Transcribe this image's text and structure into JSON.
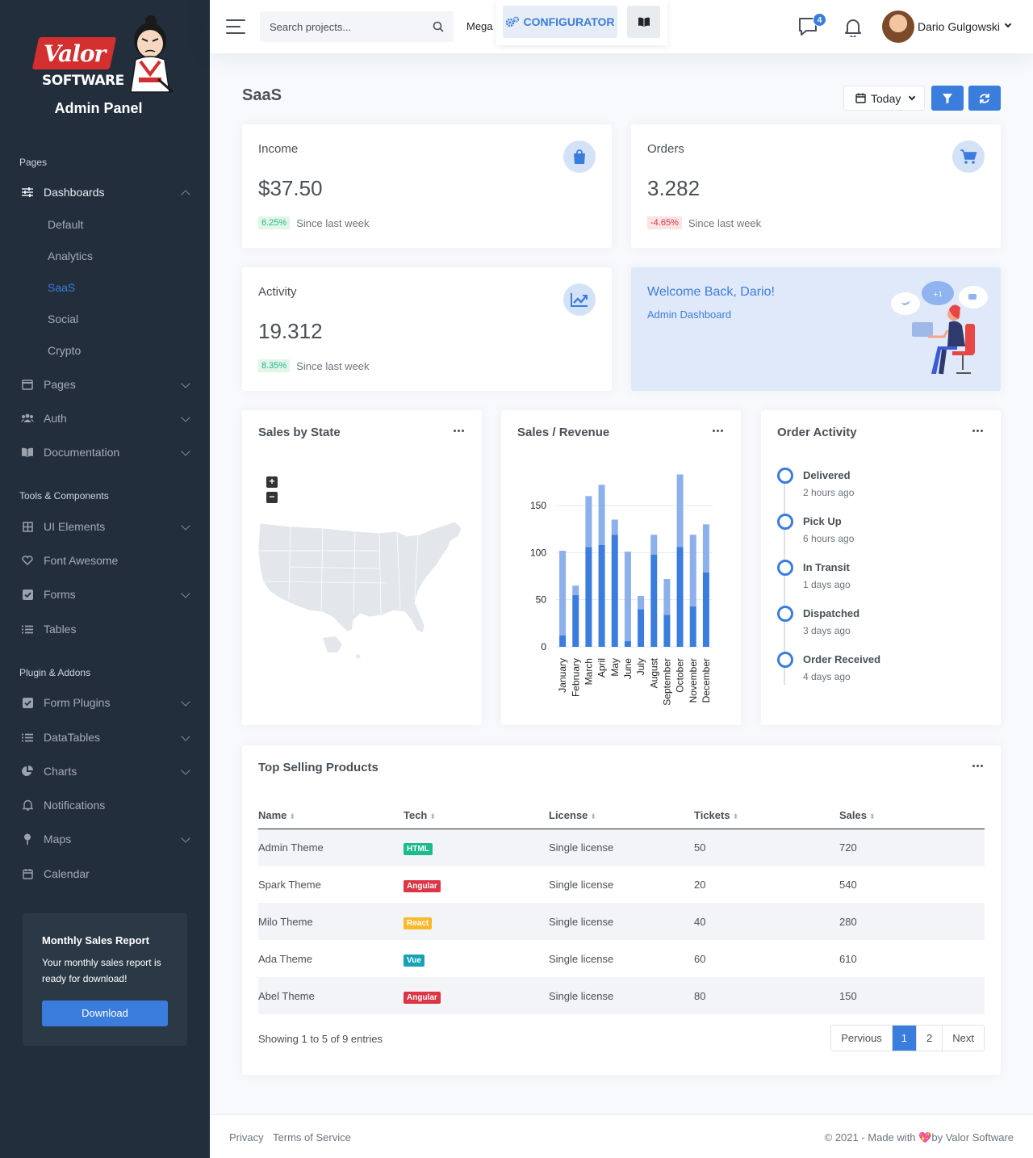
{
  "brand": {
    "logo_word": "Valor",
    "logo_sub": "SOFTWARE",
    "subtitle": "Admin Panel"
  },
  "sidebar": {
    "sections": {
      "pages": "Pages",
      "tools": "Tools & Components",
      "plugins": "Plugin & Addons"
    },
    "dashboards": {
      "label": "Dashboards",
      "children": [
        "Default",
        "Analytics",
        "SaaS",
        "Social",
        "Crypto"
      ],
      "active": "SaaS"
    },
    "items": [
      {
        "label": "Pages",
        "icon": "layout-icon"
      },
      {
        "label": "Auth",
        "icon": "users-icon"
      },
      {
        "label": "Documentation",
        "icon": "book-icon"
      },
      {
        "label": "UI Elements",
        "icon": "grid-icon"
      },
      {
        "label": "Font Awesome",
        "icon": "heart-icon"
      },
      {
        "label": "Forms",
        "icon": "check-square-icon"
      },
      {
        "label": "Tables",
        "icon": "list-icon"
      },
      {
        "label": "Form Plugins",
        "icon": "check-square-icon"
      },
      {
        "label": "DataTables",
        "icon": "list-icon"
      },
      {
        "label": "Charts",
        "icon": "pie-chart-icon"
      },
      {
        "label": "Notifications",
        "icon": "bell-icon"
      },
      {
        "label": "Maps",
        "icon": "map-pin-icon"
      },
      {
        "label": "Calendar",
        "icon": "calendar-icon"
      }
    ],
    "cta": {
      "title": "Monthly Sales Report",
      "text": "Your monthly sales report is ready for download!",
      "button": "Download"
    }
  },
  "topbar": {
    "search_placeholder": "Search projects...",
    "mega": "Mega",
    "configurator": "CONFIGURATOR",
    "messages_count": "4",
    "user_name": "Dario Gulgowski"
  },
  "header": {
    "title": "SaaS",
    "date_filter": "Today"
  },
  "stats": {
    "income": {
      "title": "Income",
      "value": "$37.50",
      "change": "6.25%",
      "note": "Since last week"
    },
    "orders": {
      "title": "Orders",
      "value": "3.282",
      "change": "-4.65%",
      "note": "Since last week"
    },
    "activity": {
      "title": "Activity",
      "value": "19.312",
      "change": "8.35%",
      "note": "Since last week"
    }
  },
  "welcome": {
    "title": "Welcome Back, Dario!",
    "subtitle": "Admin Dashboard"
  },
  "cards": {
    "map_title": "Sales by State",
    "chart_title": "Sales / Revenue",
    "timeline_title": "Order Activity",
    "table_title": "Top Selling Products"
  },
  "chart_data": {
    "type": "bar",
    "stacked": true,
    "categories": [
      "January",
      "February",
      "March",
      "April",
      "May",
      "June",
      "July",
      "August",
      "September",
      "October",
      "November",
      "December"
    ],
    "series": [
      {
        "values": [
          12,
          55,
          106,
          108,
          119,
          6,
          40,
          98,
          34,
          106,
          43,
          79
        ],
        "color": "#3b7ddd"
      },
      {
        "values": [
          90,
          10,
          54,
          64,
          16,
          95,
          14,
          21,
          38,
          77,
          76,
          51
        ],
        "color": "#8cb0eb"
      }
    ],
    "yticks": [
      0,
      50,
      100,
      150
    ],
    "ylim": [
      0,
      180
    ],
    "grid": true
  },
  "timeline": [
    {
      "title": "Delivered",
      "time": "2 hours ago"
    },
    {
      "title": "Pick Up",
      "time": "6 hours ago"
    },
    {
      "title": "In Transit",
      "time": "1 days ago"
    },
    {
      "title": "Dispatched",
      "time": "3 days ago"
    },
    {
      "title": "Order Received",
      "time": "4 days ago"
    }
  ],
  "table": {
    "columns": [
      "Name",
      "Tech",
      "License",
      "Tickets",
      "Sales"
    ],
    "rows": [
      {
        "name": "Admin Theme",
        "tech": "HTML",
        "tech_color": "#1cbb8c",
        "license": "Single license",
        "tickets": "50",
        "sales": "720"
      },
      {
        "name": "Spark Theme",
        "tech": "Angular",
        "tech_color": "#dc3545",
        "license": "Single license",
        "tickets": "20",
        "sales": "540"
      },
      {
        "name": "Milo Theme",
        "tech": "React",
        "tech_color": "#fcb92c",
        "license": "Single license",
        "tickets": "40",
        "sales": "280"
      },
      {
        "name": "Ada Theme",
        "tech": "Vue",
        "tech_color": "#17a2b8",
        "license": "Single license",
        "tickets": "60",
        "sales": "610"
      },
      {
        "name": "Abel Theme",
        "tech": "Angular",
        "tech_color": "#dc3545",
        "license": "Single license",
        "tickets": "80",
        "sales": "150"
      }
    ],
    "showing": "Showing 1 to 5 of 9 entries",
    "pager": {
      "prev": "Pervious",
      "pages": [
        "1",
        "2"
      ],
      "next": "Next",
      "current": "1"
    }
  },
  "footer": {
    "links": [
      "Privacy",
      "Terms of Service"
    ],
    "copyright_prefix": "© 2021 - Made with",
    "copyright_suffix": "by Valor Software"
  }
}
